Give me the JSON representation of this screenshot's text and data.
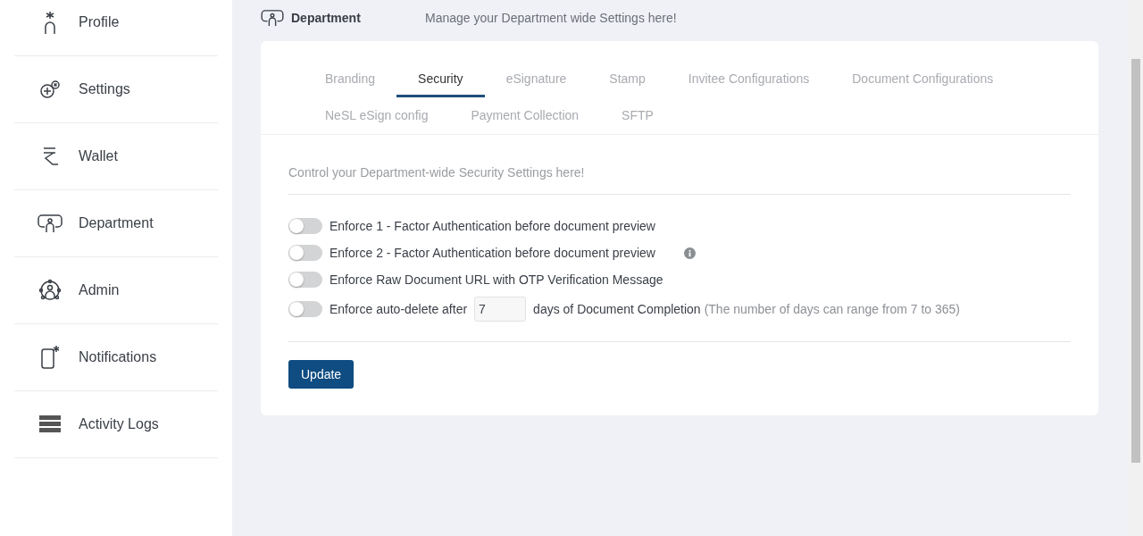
{
  "sidebar": {
    "items": [
      {
        "label": "Profile",
        "selected": false
      },
      {
        "label": "Settings",
        "selected": false
      },
      {
        "label": "Wallet",
        "selected": false
      },
      {
        "label": "Department",
        "selected": false
      },
      {
        "label": "Admin",
        "selected": false
      },
      {
        "label": "Notifications",
        "selected": false
      },
      {
        "label": "Activity Logs",
        "selected": false
      }
    ]
  },
  "header": {
    "title": "Department",
    "subtitle": "Manage your Department wide Settings here!"
  },
  "tabs": [
    {
      "label": "Branding",
      "selected": false
    },
    {
      "label": "Security",
      "selected": true
    },
    {
      "label": "eSignature",
      "selected": false
    },
    {
      "label": "Stamp",
      "selected": false
    },
    {
      "label": "Invitee Configurations",
      "selected": false
    },
    {
      "label": "Document Configurations",
      "selected": false
    },
    {
      "label": "NeSL eSign config",
      "selected": false
    },
    {
      "label": "Payment Collection",
      "selected": false
    },
    {
      "label": "SFTP",
      "selected": false
    }
  ],
  "intro": "Control your Department-wide Security Settings here!",
  "settings": [
    {
      "kind": "toggle",
      "on": false,
      "label": "Enforce 1 - Factor Authentication before document preview",
      "info": false
    },
    {
      "kind": "toggle",
      "on": false,
      "label": "Enforce 2 - Factor Authentication before document preview",
      "info": true
    },
    {
      "kind": "toggle",
      "on": false,
      "label": "Enforce Raw Document URL with OTP Verification Message",
      "info": false
    },
    {
      "kind": "days",
      "on": false,
      "label": "Enforce auto-delete after",
      "value": "7",
      "after": "days of Document Completion",
      "hint": "(The number of days can range from 7 to 365)",
      "info": false
    }
  ],
  "button": "Update"
}
